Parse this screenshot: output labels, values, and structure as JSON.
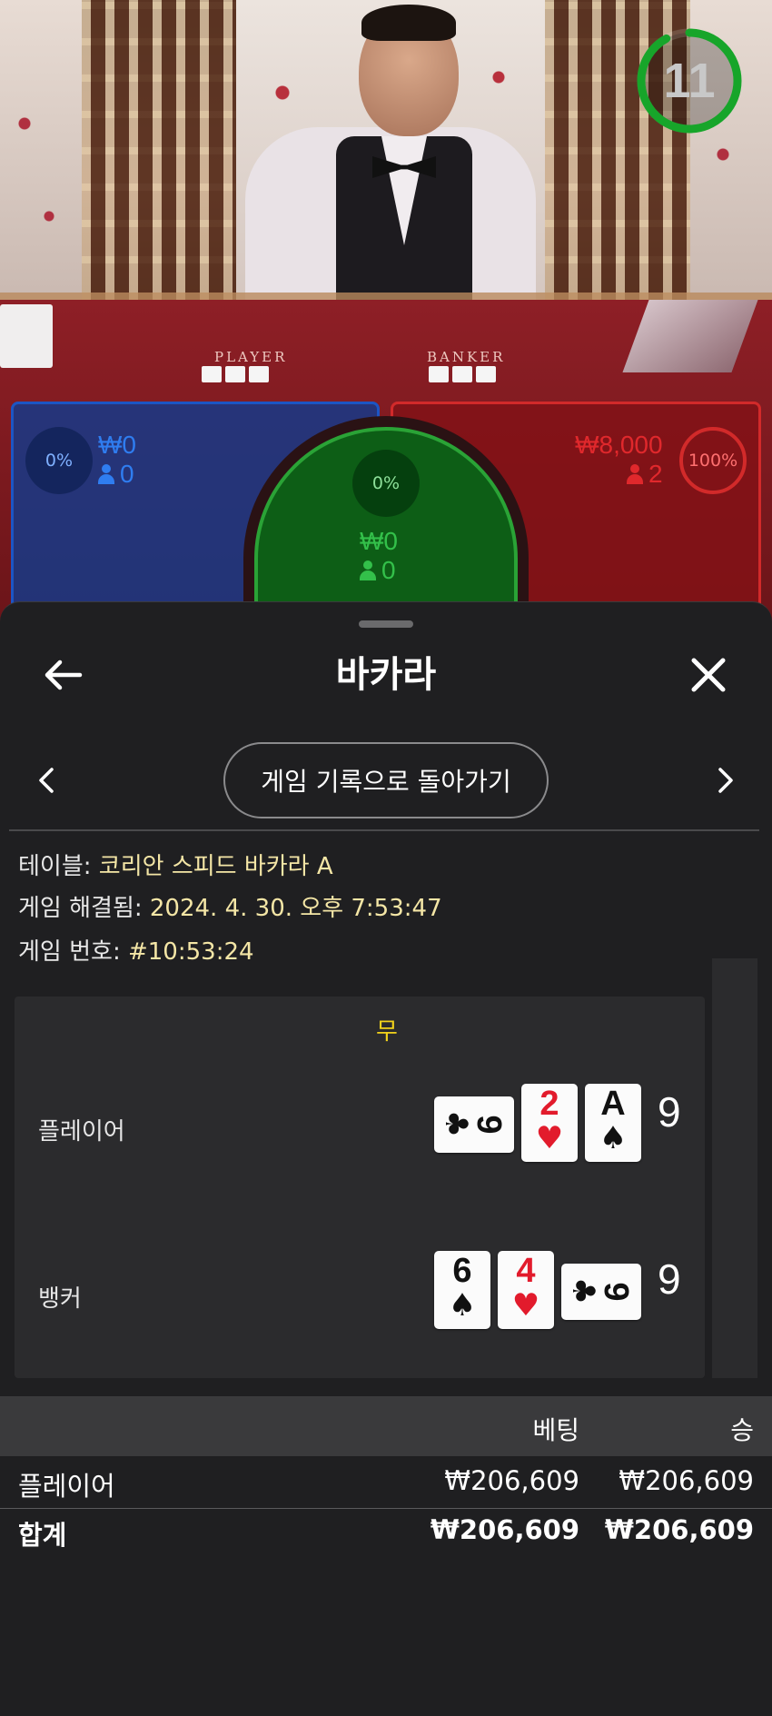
{
  "timer": {
    "seconds": "11",
    "progress": 0.92,
    "color": "#17a52a"
  },
  "table_labels": {
    "player": "PLAYER",
    "banker": "BANKER"
  },
  "betting_spots": {
    "player": {
      "percent": "0%",
      "amount": "₩0",
      "players": "0",
      "color": "#1c55c4"
    },
    "tie": {
      "percent": "0%",
      "amount": "₩0",
      "players": "0",
      "color": "#2aa336"
    },
    "banker": {
      "percent": "100%",
      "amount": "₩8,000",
      "players": "2",
      "color": "#d22a2a"
    }
  },
  "sheet": {
    "title": "바카라",
    "back_to_history": "게임 기록으로 돌아가기",
    "info": {
      "table_key": "테이블:",
      "table_value": "코리안 스피드 바카라 A",
      "settled_key": "게임 해결됨:",
      "settled_value": "2024. 4. 30. 오후 7:53:47",
      "number_key": "게임 번호:",
      "number_value": "#10:53:24"
    },
    "result": {
      "outcome": "무",
      "player": {
        "label": "플레이어",
        "score": "9",
        "cards": [
          {
            "rank": "9",
            "suit": "♣",
            "color": "black",
            "sideways": true
          },
          {
            "rank": "2",
            "suit": "♥",
            "color": "red",
            "sideways": false
          },
          {
            "rank": "A",
            "suit": "♠",
            "color": "black",
            "sideways": false
          }
        ]
      },
      "banker": {
        "label": "뱅커",
        "score": "9",
        "cards": [
          {
            "rank": "6",
            "suit": "♠",
            "color": "black",
            "sideways": false
          },
          {
            "rank": "4",
            "suit": "♥",
            "color": "red",
            "sideways": false
          },
          {
            "rank": "9",
            "suit": "♣",
            "color": "black",
            "sideways": true
          }
        ]
      }
    },
    "bets": {
      "headers": {
        "bet": "베팅",
        "win": "승"
      },
      "rows": [
        {
          "name": "플레이어",
          "bet": "₩206,609",
          "win": "₩206,609"
        }
      ],
      "total": {
        "name": "합계",
        "bet": "₩206,609",
        "win": "₩206,609"
      }
    }
  }
}
